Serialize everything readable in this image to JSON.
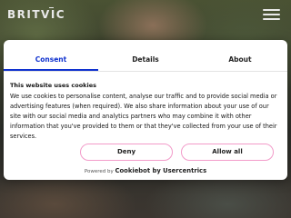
{
  "header": {
    "logo_text": "BRITVIC"
  },
  "consent": {
    "tabs": [
      {
        "label": "Consent"
      },
      {
        "label": "Details"
      },
      {
        "label": "About"
      }
    ],
    "heading": "This website uses cookies",
    "body": "We use cookies to personalise content, analyse our traffic and to provide social media or advertising features (when required). We also share information about your use of our site with our social media and analytics partners who may combine it with other information that you've provided to them or that they've collected from your use of their services.",
    "deny_label": "Deny",
    "allow_label": "Allow all",
    "powered_by": "Powered by",
    "brand": "Cookiebot by Usercentrics",
    "colors": {
      "active_tab": "#1032cf",
      "button_border": "#f29bc9"
    }
  }
}
